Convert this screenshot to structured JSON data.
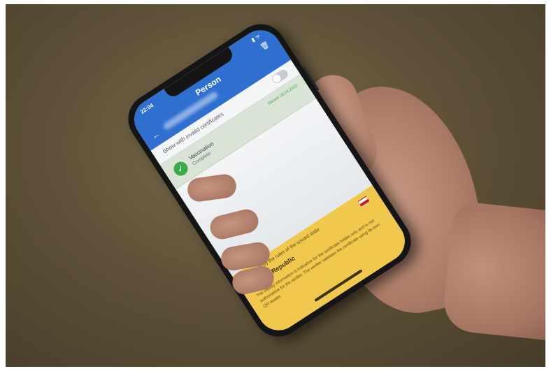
{
  "app": {
    "status_time": "22:04",
    "status_icons": "▮ ᯤ",
    "title": "Person",
    "back_icon": "←",
    "delete_icon": "🗑"
  },
  "toggle": {
    "label": "Show with invalid certificates"
  },
  "certificate": {
    "type": "Vaccination",
    "status": "Complete",
    "date": "Issued 18.04.2022"
  },
  "info_panel": {
    "line1": "Valid only by the rules of the issued state",
    "country": "Czech Republic",
    "notice": "The validity information is indicative for the certificate holder only and is not authoritative for the verifier. The verifier validates the certificate using its own QR reader."
  }
}
